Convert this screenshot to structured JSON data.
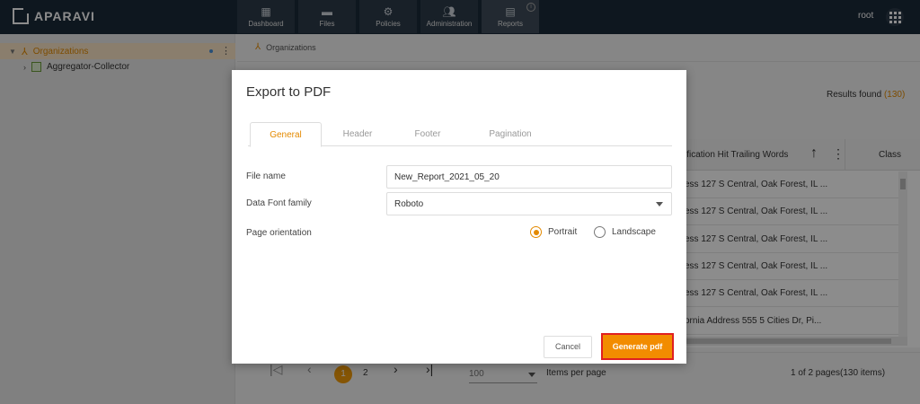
{
  "topbar": {
    "logo_text": "APARAVI",
    "nav": [
      {
        "label": "Dashboard",
        "icon": "dashboard-icon"
      },
      {
        "label": "Files",
        "icon": "folder-icon"
      },
      {
        "label": "Policies",
        "icon": "gear-icon"
      },
      {
        "label": "Administration",
        "icon": "users-icon"
      },
      {
        "label": "Reports",
        "icon": "report-icon",
        "active": true
      }
    ],
    "user": "root"
  },
  "sidebar": {
    "root_label": "Organizations",
    "child_label": "Aggregator-Collector"
  },
  "main": {
    "breadcrumb": "Organizations",
    "results_label": "Results found",
    "results_count": "(130)",
    "table": {
      "col1_header": "ification Hit Trailing Words",
      "col2_header": "Class",
      "rows": [
        "ess 127 S Central, Oak Forest, IL ...",
        "ess 127 S Central, Oak Forest, IL ...",
        "ess 127 S Central, Oak Forest, IL ...",
        "ess 127 S Central, Oak Forest, IL ...",
        "ess 127 S Central, Oak Forest, IL ...",
        "ornia Address 555 5 Cities Dr, Pi..."
      ]
    },
    "pagination": {
      "current_page": "1",
      "next_page": "2",
      "items_per_page": "100",
      "items_per_page_label": "Items per page",
      "pages_info": "1 of 2 pages(130 items)"
    }
  },
  "modal": {
    "title": "Export to PDF",
    "tabs": [
      "General",
      "Header",
      "Footer",
      "Pagination"
    ],
    "file_name_label": "File name",
    "file_name_value": "New_Report_2021_05_20",
    "font_label": "Data Font family",
    "font_value": "Roboto",
    "orientation_label": "Page orientation",
    "portrait_label": "Portrait",
    "landscape_label": "Landscape",
    "cancel_label": "Cancel",
    "generate_label": "Generate pdf"
  },
  "colors": {
    "accent": "#e48a00",
    "topbar": "#1b2a3a",
    "generate_button": "#f28c00",
    "highlight_border": "#e02020"
  }
}
